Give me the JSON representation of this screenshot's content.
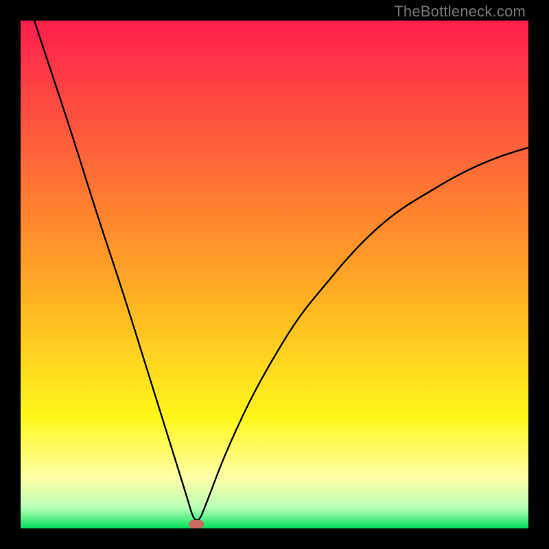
{
  "watermark": "TheBottleneck.com",
  "gradient": {
    "stops": [
      {
        "offset": 0,
        "color": "#ff1f4e"
      },
      {
        "offset": 50,
        "color": "#ffa325"
      },
      {
        "offset": 78,
        "color": "#fff71a"
      },
      {
        "offset": 90,
        "color": "#ffffa8"
      },
      {
        "offset": 96,
        "color": "#b7ffb6"
      },
      {
        "offset": 100,
        "color": "#00e05a"
      }
    ]
  },
  "marker": {
    "x_fraction": 0.346,
    "color": "#cb6a5f"
  },
  "chart_data": {
    "type": "line",
    "title": "",
    "xlabel": "",
    "ylabel": "",
    "xlim": [
      0,
      1
    ],
    "ylim": [
      0,
      100
    ],
    "notes": "V-shaped bottleneck curve. Y-axis encodes percentage bottleneck (0 at bottom/green, 100 at top/red). X-axis is an unlabeled normalized parameter with optimal point (minimum) near x≈0.346.",
    "series": [
      {
        "name": "bottleneck-curve",
        "x": [
          0.027,
          0.05,
          0.1,
          0.15,
          0.2,
          0.25,
          0.3,
          0.325,
          0.346,
          0.37,
          0.4,
          0.45,
          0.5,
          0.55,
          0.6,
          0.65,
          0.7,
          0.75,
          0.8,
          0.85,
          0.9,
          0.95,
          1.0
        ],
        "values": [
          100,
          93,
          78,
          62,
          47,
          31,
          15,
          7,
          0,
          6,
          14,
          25,
          34,
          42,
          48,
          54,
          59,
          63,
          66,
          69,
          71.5,
          73.5,
          75
        ]
      }
    ],
    "background_gradient_meaning": {
      "0": "severe bottleneck",
      "50": "moderate",
      "100": "no bottleneck"
    },
    "optimal_point": {
      "x": 0.346,
      "value": 0
    }
  }
}
